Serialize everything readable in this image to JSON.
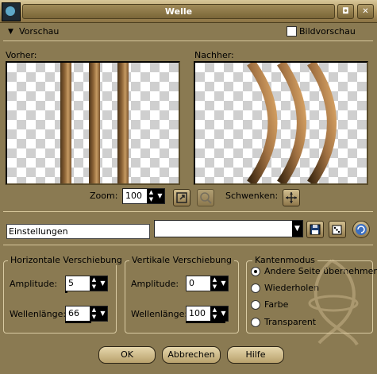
{
  "window": {
    "title": "Welle"
  },
  "preview": {
    "toggle_label": "Vorschau",
    "full_preview_label": "Bildvorschau",
    "before_label": "Vorher:",
    "after_label": "Nachher:",
    "zoom_label": "Zoom:",
    "zoom_value": "100",
    "pan_label": "Schwenken:"
  },
  "settings": {
    "label": "Einstellungen",
    "preset_value": ""
  },
  "horizontal": {
    "title": "Horizontale Verschiebung",
    "amplitude_label": "Amplitude:",
    "amplitude_value": "5",
    "wavelength_label": "Wellenlänge:",
    "wavelength_value": "66"
  },
  "vertical": {
    "title": "Vertikale Verschiebung",
    "amplitude_label": "Amplitude:",
    "amplitude_value": "0",
    "wavelength_label": "Wellenlänge:",
    "wavelength_value": "100"
  },
  "edge_mode": {
    "title": "Kantenmodus",
    "options": [
      "Andere Seite übernehmen",
      "Wiederholen",
      "Farbe",
      "Transparent"
    ],
    "selected": "Andere Seite übernehmen"
  },
  "buttons": {
    "ok": "OK",
    "cancel": "Abbrechen",
    "help": "Hilfe"
  },
  "colors": {
    "dialog_bg": "#8a7a52",
    "stripe": "#a77944"
  }
}
